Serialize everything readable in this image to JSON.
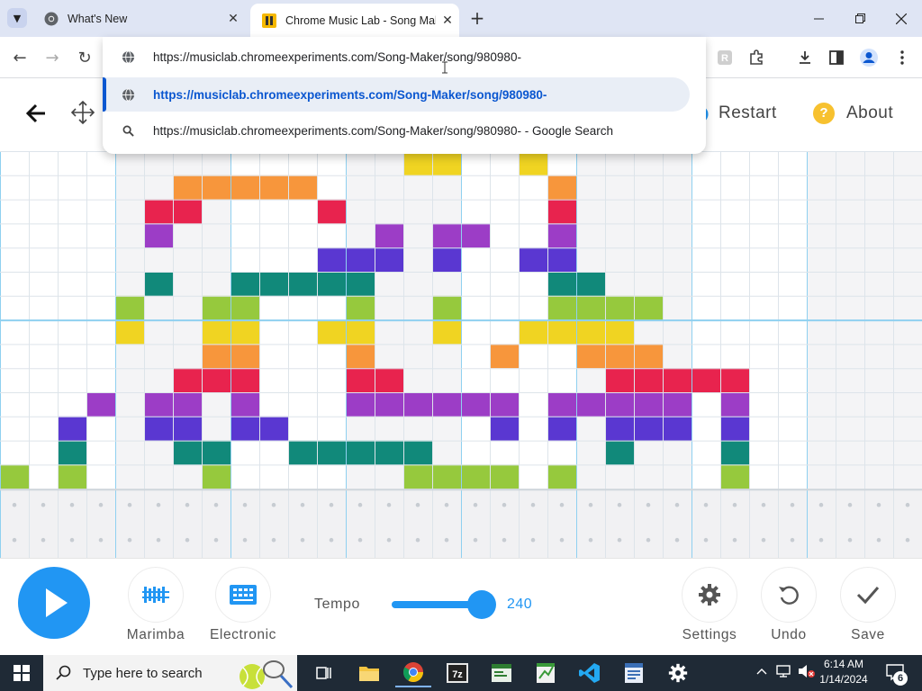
{
  "browser": {
    "tabs": [
      {
        "title": "What's New",
        "icon": "chrome-icon"
      },
      {
        "title": "Chrome Music Lab - Song Maker",
        "icon": "musiclab-icon"
      }
    ],
    "new_tab": "+",
    "address": "https://musiclab.chromeexperiments.com/Song-Maker/song/980980-",
    "suggestions": [
      {
        "text": "https://musiclab.chromeexperiments.com/Song-Maker/song/980980-",
        "icon": "globe-icon"
      },
      {
        "text": "https://musiclab.chromeexperiments.com/Song-Maker/song/980980-",
        "icon": "globe-icon",
        "selected": true
      },
      {
        "text": "https://musiclab.chromeexperiments.com/Song-Maker/song/980980- - Google Search",
        "icon": "search-icon"
      }
    ]
  },
  "app": {
    "header": {
      "restart": "Restart",
      "about": "About",
      "about_icon_glyph": "?"
    },
    "controls": {
      "instrument1": "Marimba",
      "instrument2": "Electronic",
      "tempo_label": "Tempo",
      "tempo_value": "240",
      "tempo_fraction": 0.98,
      "settings": "Settings",
      "undo": "Undo",
      "save": "Save"
    },
    "colors": {
      "accent": "#2196f3",
      "notes": [
        "#96c93d",
        "#11897a",
        "#5a37d1",
        "#9c3dc6",
        "#e8234e",
        "#f7963c",
        "#f0d422"
      ]
    },
    "notes": [
      {
        "row": 0,
        "col": 14,
        "c": 6
      },
      {
        "row": 0,
        "col": 15,
        "c": 6
      },
      {
        "row": 0,
        "col": 18,
        "c": 6
      },
      {
        "row": 1,
        "col": 6,
        "c": 5
      },
      {
        "row": 1,
        "col": 7,
        "c": 5
      },
      {
        "row": 1,
        "col": 8,
        "c": 5
      },
      {
        "row": 1,
        "col": 9,
        "c": 5
      },
      {
        "row": 1,
        "col": 10,
        "c": 5
      },
      {
        "row": 1,
        "col": 19,
        "c": 5
      },
      {
        "row": 2,
        "col": 5,
        "c": 4
      },
      {
        "row": 2,
        "col": 6,
        "c": 4
      },
      {
        "row": 2,
        "col": 11,
        "c": 4
      },
      {
        "row": 2,
        "col": 19,
        "c": 4
      },
      {
        "row": 3,
        "col": 5,
        "c": 3
      },
      {
        "row": 3,
        "col": 13,
        "c": 3
      },
      {
        "row": 3,
        "col": 15,
        "c": 3
      },
      {
        "row": 3,
        "col": 16,
        "c": 3
      },
      {
        "row": 3,
        "col": 19,
        "c": 3
      },
      {
        "row": 4,
        "col": 11,
        "c": 2
      },
      {
        "row": 4,
        "col": 12,
        "c": 2
      },
      {
        "row": 4,
        "col": 13,
        "c": 2
      },
      {
        "row": 4,
        "col": 15,
        "c": 2
      },
      {
        "row": 4,
        "col": 18,
        "c": 2
      },
      {
        "row": 4,
        "col": 19,
        "c": 2
      },
      {
        "row": 5,
        "col": 5,
        "c": 1
      },
      {
        "row": 5,
        "col": 8,
        "c": 1
      },
      {
        "row": 5,
        "col": 9,
        "c": 1
      },
      {
        "row": 5,
        "col": 10,
        "c": 1
      },
      {
        "row": 5,
        "col": 11,
        "c": 1
      },
      {
        "row": 5,
        "col": 12,
        "c": 1
      },
      {
        "row": 5,
        "col": 19,
        "c": 1
      },
      {
        "row": 5,
        "col": 20,
        "c": 1
      },
      {
        "row": 6,
        "col": 4,
        "c": 0
      },
      {
        "row": 6,
        "col": 7,
        "c": 0
      },
      {
        "row": 6,
        "col": 8,
        "c": 0
      },
      {
        "row": 6,
        "col": 12,
        "c": 0
      },
      {
        "row": 6,
        "col": 15,
        "c": 0
      },
      {
        "row": 6,
        "col": 19,
        "c": 0
      },
      {
        "row": 6,
        "col": 20,
        "c": 0
      },
      {
        "row": 6,
        "col": 21,
        "c": 0
      },
      {
        "row": 6,
        "col": 22,
        "c": 0
      },
      {
        "row": 7,
        "col": 4,
        "c": 6
      },
      {
        "row": 7,
        "col": 7,
        "c": 6
      },
      {
        "row": 7,
        "col": 8,
        "c": 6
      },
      {
        "row": 7,
        "col": 11,
        "c": 6
      },
      {
        "row": 7,
        "col": 12,
        "c": 6
      },
      {
        "row": 7,
        "col": 15,
        "c": 6
      },
      {
        "row": 7,
        "col": 18,
        "c": 6
      },
      {
        "row": 7,
        "col": 19,
        "c": 6
      },
      {
        "row": 7,
        "col": 20,
        "c": 6
      },
      {
        "row": 7,
        "col": 21,
        "c": 6
      },
      {
        "row": 8,
        "col": 7,
        "c": 5
      },
      {
        "row": 8,
        "col": 8,
        "c": 5
      },
      {
        "row": 8,
        "col": 12,
        "c": 5
      },
      {
        "row": 8,
        "col": 17,
        "c": 5
      },
      {
        "row": 8,
        "col": 20,
        "c": 5
      },
      {
        "row": 8,
        "col": 21,
        "c": 5
      },
      {
        "row": 8,
        "col": 22,
        "c": 5
      },
      {
        "row": 9,
        "col": 6,
        "c": 4
      },
      {
        "row": 9,
        "col": 7,
        "c": 4
      },
      {
        "row": 9,
        "col": 8,
        "c": 4
      },
      {
        "row": 9,
        "col": 12,
        "c": 4
      },
      {
        "row": 9,
        "col": 13,
        "c": 4
      },
      {
        "row": 9,
        "col": 21,
        "c": 4
      },
      {
        "row": 9,
        "col": 22,
        "c": 4
      },
      {
        "row": 9,
        "col": 23,
        "c": 4
      },
      {
        "row": 9,
        "col": 24,
        "c": 4
      },
      {
        "row": 9,
        "col": 25,
        "c": 4
      },
      {
        "row": 10,
        "col": 3,
        "c": 3
      },
      {
        "row": 10,
        "col": 5,
        "c": 3
      },
      {
        "row": 10,
        "col": 6,
        "c": 3
      },
      {
        "row": 10,
        "col": 8,
        "c": 3
      },
      {
        "row": 10,
        "col": 12,
        "c": 3
      },
      {
        "row": 10,
        "col": 13,
        "c": 3
      },
      {
        "row": 10,
        "col": 14,
        "c": 3
      },
      {
        "row": 10,
        "col": 15,
        "c": 3
      },
      {
        "row": 10,
        "col": 16,
        "c": 3
      },
      {
        "row": 10,
        "col": 17,
        "c": 3
      },
      {
        "row": 10,
        "col": 19,
        "c": 3
      },
      {
        "row": 10,
        "col": 20,
        "c": 3
      },
      {
        "row": 10,
        "col": 21,
        "c": 3
      },
      {
        "row": 10,
        "col": 22,
        "c": 3
      },
      {
        "row": 10,
        "col": 23,
        "c": 3
      },
      {
        "row": 10,
        "col": 25,
        "c": 3
      },
      {
        "row": 11,
        "col": 2,
        "c": 2
      },
      {
        "row": 11,
        "col": 5,
        "c": 2
      },
      {
        "row": 11,
        "col": 6,
        "c": 2
      },
      {
        "row": 11,
        "col": 8,
        "c": 2
      },
      {
        "row": 11,
        "col": 9,
        "c": 2
      },
      {
        "row": 11,
        "col": 17,
        "c": 2
      },
      {
        "row": 11,
        "col": 19,
        "c": 2
      },
      {
        "row": 11,
        "col": 21,
        "c": 2
      },
      {
        "row": 11,
        "col": 22,
        "c": 2
      },
      {
        "row": 11,
        "col": 23,
        "c": 2
      },
      {
        "row": 11,
        "col": 25,
        "c": 2
      },
      {
        "row": 12,
        "col": 2,
        "c": 1
      },
      {
        "row": 12,
        "col": 6,
        "c": 1
      },
      {
        "row": 12,
        "col": 7,
        "c": 1
      },
      {
        "row": 12,
        "col": 10,
        "c": 1
      },
      {
        "row": 12,
        "col": 11,
        "c": 1
      },
      {
        "row": 12,
        "col": 12,
        "c": 1
      },
      {
        "row": 12,
        "col": 13,
        "c": 1
      },
      {
        "row": 12,
        "col": 14,
        "c": 1
      },
      {
        "row": 12,
        "col": 21,
        "c": 1
      },
      {
        "row": 12,
        "col": 25,
        "c": 1
      },
      {
        "row": 13,
        "col": 0,
        "c": 0
      },
      {
        "row": 13,
        "col": 2,
        "c": 0
      },
      {
        "row": 13,
        "col": 7,
        "c": 0
      },
      {
        "row": 13,
        "col": 14,
        "c": 0
      },
      {
        "row": 13,
        "col": 15,
        "c": 0
      },
      {
        "row": 13,
        "col": 16,
        "c": 0
      },
      {
        "row": 13,
        "col": 17,
        "c": 0
      },
      {
        "row": 13,
        "col": 19,
        "c": 0
      },
      {
        "row": 13,
        "col": 25,
        "c": 0
      }
    ],
    "percussion": []
  },
  "taskbar": {
    "search_placeholder": "Type here to search",
    "time": "6:14 AM",
    "date": "1/14/2024",
    "notif_count": "6",
    "apps": [
      "task-view-icon",
      "file-explorer-icon",
      "chrome-icon",
      "7zip-icon",
      "app-icon",
      "spreadsheet-icon",
      "vscode-icon",
      "document-icon",
      "settings-gear-icon"
    ]
  }
}
